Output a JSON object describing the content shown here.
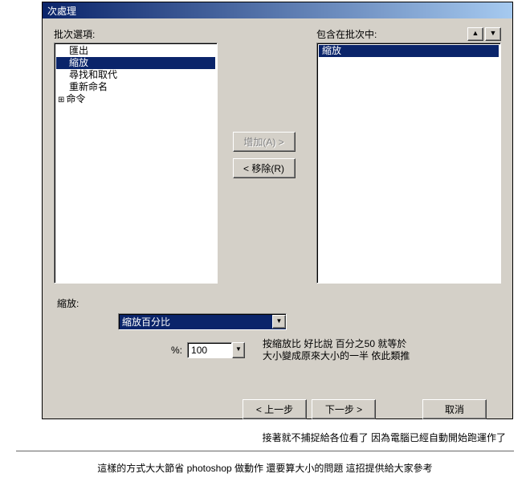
{
  "window": {
    "title": "次處理"
  },
  "left": {
    "label": "批次選項:",
    "items": [
      "匯出",
      "縮放",
      "尋找和取代",
      "重新命名"
    ],
    "root": "命令",
    "selected_index": 1
  },
  "right": {
    "label": "包含在批次中:",
    "items": [
      "縮放"
    ],
    "selected_index": 0
  },
  "buttons": {
    "add": "增加(A) >",
    "remove": "< 移除(R)",
    "prev": "< 上一步",
    "next": "下一步 >",
    "cancel": "取消"
  },
  "zoom": {
    "section_label": "縮放:",
    "mode": "縮放百分比",
    "pct_label": "%:",
    "pct_value": "100"
  },
  "annotation": {
    "line1": "按縮放比 好比說 百分之50 就等於",
    "line2": "大小變成原來大小的一半 依此類推"
  },
  "caption": "接著就不捕捉給各位看了 因為電腦已經自動開始跑運作了",
  "footnote": "這樣的方式大大節省 photoshop 做動作 還要算大小的問題 這招提供給大家參考"
}
